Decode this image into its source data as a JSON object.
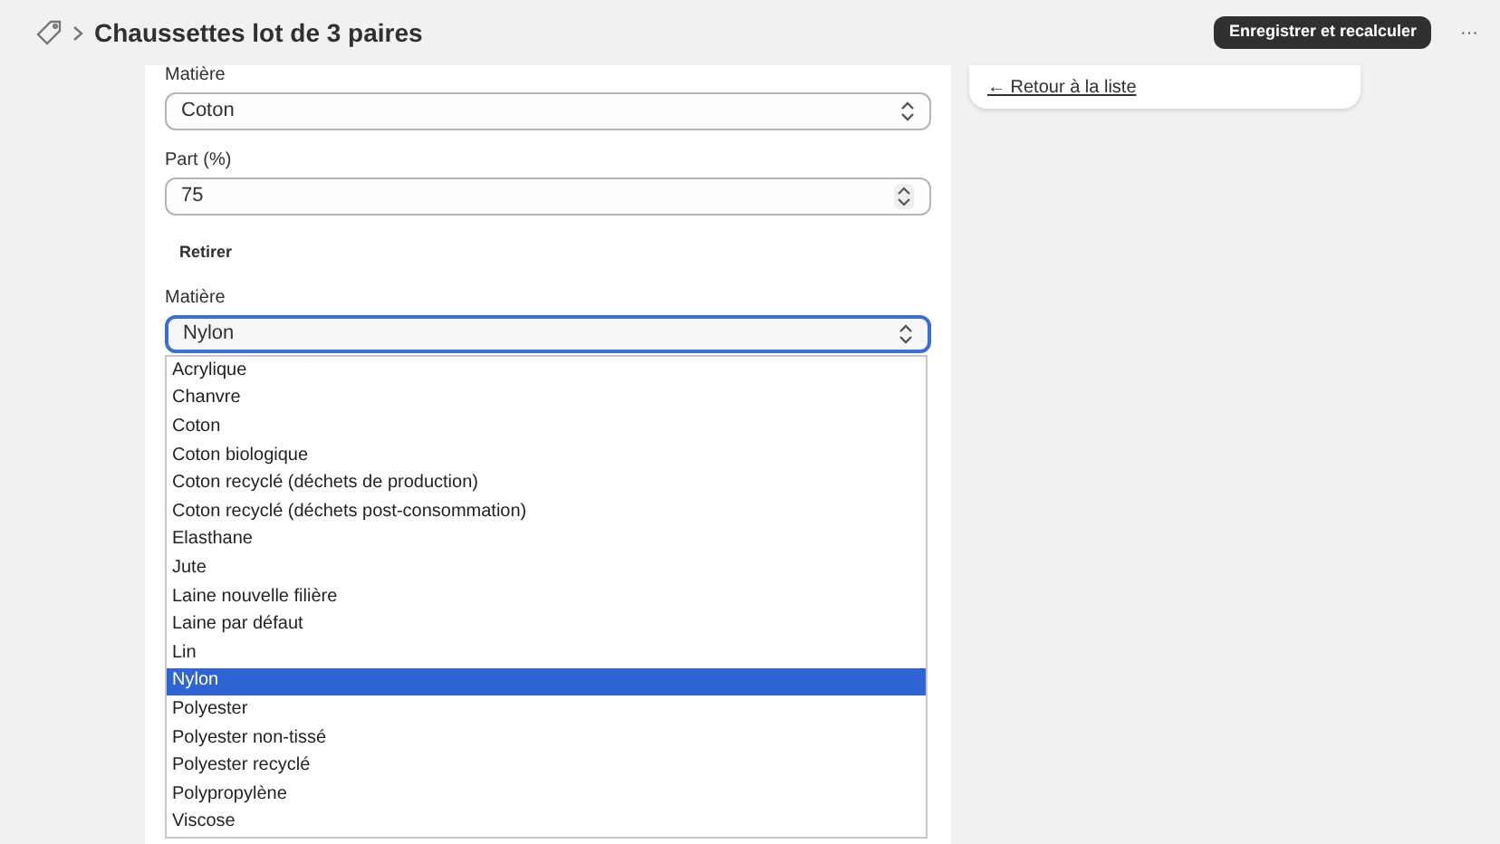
{
  "header": {
    "title": "Chaussettes lot de 3 paires",
    "save_button": "Enregistrer et recalculer",
    "more_button": "···"
  },
  "fields": [
    {
      "kind": "select",
      "label": "Matière",
      "value": "Coton",
      "focused": false
    },
    {
      "kind": "number",
      "label": "Part (%)",
      "value": "75"
    },
    {
      "kind": "action",
      "label": "Retirer"
    },
    {
      "kind": "select",
      "label": "Matière",
      "value": "Nylon",
      "focused": true
    }
  ],
  "dropdown": {
    "options": [
      {
        "label": "Acrylique",
        "selected": false
      },
      {
        "label": "Chanvre",
        "selected": false
      },
      {
        "label": "Coton",
        "selected": false
      },
      {
        "label": "Coton biologique",
        "selected": false
      },
      {
        "label": "Coton recyclé (déchets de production)",
        "selected": false
      },
      {
        "label": "Coton recyclé (déchets post-consommation)",
        "selected": false
      },
      {
        "label": "Elasthane",
        "selected": false
      },
      {
        "label": "Jute",
        "selected": false
      },
      {
        "label": "Laine nouvelle filière",
        "selected": false
      },
      {
        "label": "Laine par défaut",
        "selected": false
      },
      {
        "label": "Lin",
        "selected": false
      },
      {
        "label": "Nylon",
        "selected": true
      },
      {
        "label": "Polyester",
        "selected": false
      },
      {
        "label": "Polyester non-tissé",
        "selected": false
      },
      {
        "label": "Polyester recyclé",
        "selected": false
      },
      {
        "label": "Polypropylène",
        "selected": false
      },
      {
        "label": "Viscose",
        "selected": false
      }
    ]
  },
  "side": {
    "back_link": "← Retour à la liste"
  }
}
